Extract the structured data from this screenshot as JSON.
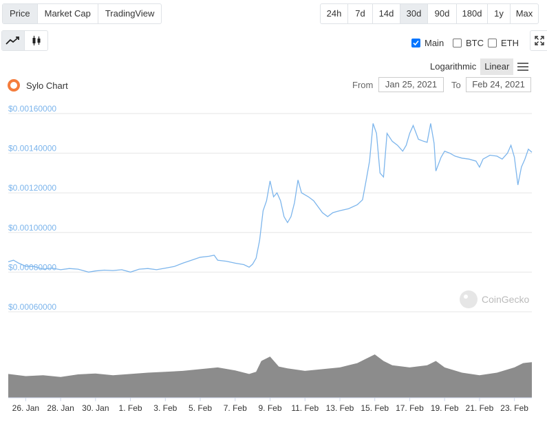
{
  "type_tabs": [
    {
      "label": "Price",
      "active": true
    },
    {
      "label": "Market Cap",
      "active": false
    },
    {
      "label": "TradingView",
      "active": false
    }
  ],
  "range_tabs": [
    {
      "label": "24h",
      "active": false
    },
    {
      "label": "7d",
      "active": false
    },
    {
      "label": "14d",
      "active": false
    },
    {
      "label": "30d",
      "active": true
    },
    {
      "label": "90d",
      "active": false
    },
    {
      "label": "180d",
      "active": false
    },
    {
      "label": "1y",
      "active": false
    },
    {
      "label": "Max",
      "active": false
    }
  ],
  "style_buttons": {
    "line_icon": "line-chart-icon",
    "candle_icon": "candlestick-icon",
    "active": "line"
  },
  "expand_icon": "fullscreen-icon",
  "compare": [
    {
      "label": "Main",
      "checked": true
    },
    {
      "label": "BTC",
      "checked": false
    },
    {
      "label": "ETH",
      "checked": false
    }
  ],
  "scale": {
    "log_label": "Logarithmic",
    "linear_label": "Linear",
    "active": "Linear",
    "menu_icon": "hamburger-menu-icon"
  },
  "legend": {
    "label": "Sylo Chart",
    "color": "#f47c3c"
  },
  "range": {
    "from_label": "From",
    "from_value": "Jan 25, 2021",
    "to_label": "To",
    "to_value": "Feb 24, 2021"
  },
  "watermark": "CoinGecko",
  "colors": {
    "line": "#7cb5ec",
    "volume": "#8c8c8c",
    "grid": "#e6e6e6"
  },
  "chart_data": {
    "type": "line",
    "ylim": [
      0.0006,
      0.0016
    ],
    "yticks": [
      "$0.00160000",
      "$0.00140000",
      "$0.00120000",
      "$0.00100000",
      "$0.00080000",
      "$0.00060000"
    ],
    "xticks": [
      "26. Jan",
      "28. Jan",
      "30. Jan",
      "1. Feb",
      "3. Feb",
      "5. Feb",
      "7. Feb",
      "9. Feb",
      "11. Feb",
      "13. Feb",
      "15. Feb",
      "17. Feb",
      "19. Feb",
      "21. Feb",
      "23. Feb"
    ],
    "xrange_days": [
      0,
      30
    ],
    "series": [
      {
        "values": [
          [
            0.0,
            0.000852
          ],
          [
            0.3,
            0.00086
          ],
          [
            0.6,
            0.000845
          ],
          [
            1.0,
            0.00083
          ],
          [
            1.5,
            0.000828
          ],
          [
            2.0,
            0.000815
          ],
          [
            2.5,
            0.00082
          ],
          [
            3.0,
            0.000812
          ],
          [
            3.5,
            0.000818
          ],
          [
            4.0,
            0.000815
          ],
          [
            4.6,
            0.0008
          ],
          [
            5.0,
            0.000806
          ],
          [
            5.5,
            0.00081
          ],
          [
            6.0,
            0.000808
          ],
          [
            6.5,
            0.000812
          ],
          [
            7.0,
            0.0008
          ],
          [
            7.5,
            0.000815
          ],
          [
            8.0,
            0.000818
          ],
          [
            8.5,
            0.000812
          ],
          [
            9.0,
            0.00082
          ],
          [
            9.5,
            0.000828
          ],
          [
            10.0,
            0.000845
          ],
          [
            10.5,
            0.00086
          ],
          [
            11.0,
            0.000875
          ],
          [
            11.5,
            0.00088
          ],
          [
            11.8,
            0.000885
          ],
          [
            12.0,
            0.00086
          ],
          [
            12.5,
            0.000855
          ],
          [
            13.0,
            0.000845
          ],
          [
            13.5,
            0.000838
          ],
          [
            13.8,
            0.000825
          ],
          [
            14.0,
            0.00084
          ],
          [
            14.2,
            0.00087
          ],
          [
            14.4,
            0.00096
          ],
          [
            14.6,
            0.00111
          ],
          [
            14.8,
            0.00116
          ],
          [
            15.0,
            0.00126
          ],
          [
            15.2,
            0.00118
          ],
          [
            15.4,
            0.0012
          ],
          [
            15.6,
            0.00116
          ],
          [
            15.8,
            0.00108
          ],
          [
            16.0,
            0.00105
          ],
          [
            16.2,
            0.00108
          ],
          [
            16.4,
            0.00115
          ],
          [
            16.6,
            0.001265
          ],
          [
            16.8,
            0.0012
          ],
          [
            17.0,
            0.00119
          ],
          [
            17.2,
            0.00118
          ],
          [
            17.5,
            0.00116
          ],
          [
            18.0,
            0.0011
          ],
          [
            18.3,
            0.00108
          ],
          [
            18.6,
            0.0011
          ],
          [
            19.0,
            0.00111
          ],
          [
            19.5,
            0.00112
          ],
          [
            20.0,
            0.00114
          ],
          [
            20.3,
            0.001165
          ],
          [
            20.5,
            0.00126
          ],
          [
            20.7,
            0.00136
          ],
          [
            20.9,
            0.00155
          ],
          [
            21.1,
            0.0015
          ],
          [
            21.3,
            0.0013
          ],
          [
            21.5,
            0.00128
          ],
          [
            21.7,
            0.0015
          ],
          [
            22.0,
            0.00146
          ],
          [
            22.3,
            0.00144
          ],
          [
            22.6,
            0.00141
          ],
          [
            22.8,
            0.00144
          ],
          [
            23.0,
            0.0015
          ],
          [
            23.2,
            0.00154
          ],
          [
            23.5,
            0.00147
          ],
          [
            23.8,
            0.00146
          ],
          [
            24.0,
            0.001455
          ],
          [
            24.2,
            0.00155
          ],
          [
            24.4,
            0.00145
          ],
          [
            24.5,
            0.00131
          ],
          [
            24.8,
            0.00138
          ],
          [
            25.0,
            0.00141
          ],
          [
            25.3,
            0.0014
          ],
          [
            25.6,
            0.001385
          ],
          [
            26.0,
            0.001375
          ],
          [
            26.4,
            0.00137
          ],
          [
            26.8,
            0.00136
          ],
          [
            27.0,
            0.00133
          ],
          [
            27.2,
            0.00137
          ],
          [
            27.6,
            0.00139
          ],
          [
            28.0,
            0.001385
          ],
          [
            28.3,
            0.00137
          ],
          [
            28.6,
            0.0014
          ],
          [
            28.8,
            0.00144
          ],
          [
            29.0,
            0.00138
          ],
          [
            29.2,
            0.00124
          ],
          [
            29.4,
            0.00133
          ],
          [
            29.6,
            0.00137
          ],
          [
            29.8,
            0.00142
          ],
          [
            30.0,
            0.001405
          ]
        ]
      }
    ],
    "volume": {
      "values": [
        [
          0.0,
          0.55
        ],
        [
          1.0,
          0.5
        ],
        [
          2.0,
          0.52
        ],
        [
          3.0,
          0.48
        ],
        [
          4.0,
          0.54
        ],
        [
          5.0,
          0.56
        ],
        [
          6.0,
          0.52
        ],
        [
          7.0,
          0.55
        ],
        [
          8.0,
          0.58
        ],
        [
          9.0,
          0.6
        ],
        [
          10.0,
          0.62
        ],
        [
          11.0,
          0.66
        ],
        [
          12.0,
          0.7
        ],
        [
          13.0,
          0.63
        ],
        [
          13.8,
          0.55
        ],
        [
          14.2,
          0.6
        ],
        [
          14.5,
          0.85
        ],
        [
          15.0,
          0.95
        ],
        [
          15.5,
          0.72
        ],
        [
          16.0,
          0.68
        ],
        [
          17.0,
          0.62
        ],
        [
          18.0,
          0.66
        ],
        [
          19.0,
          0.7
        ],
        [
          20.0,
          0.8
        ],
        [
          20.5,
          0.9
        ],
        [
          21.0,
          1.0
        ],
        [
          21.5,
          0.85
        ],
        [
          22.0,
          0.75
        ],
        [
          23.0,
          0.7
        ],
        [
          24.0,
          0.75
        ],
        [
          24.5,
          0.85
        ],
        [
          25.0,
          0.7
        ],
        [
          26.0,
          0.58
        ],
        [
          27.0,
          0.52
        ],
        [
          28.0,
          0.58
        ],
        [
          29.0,
          0.7
        ],
        [
          29.5,
          0.8
        ],
        [
          30.0,
          0.82
        ]
      ]
    }
  }
}
